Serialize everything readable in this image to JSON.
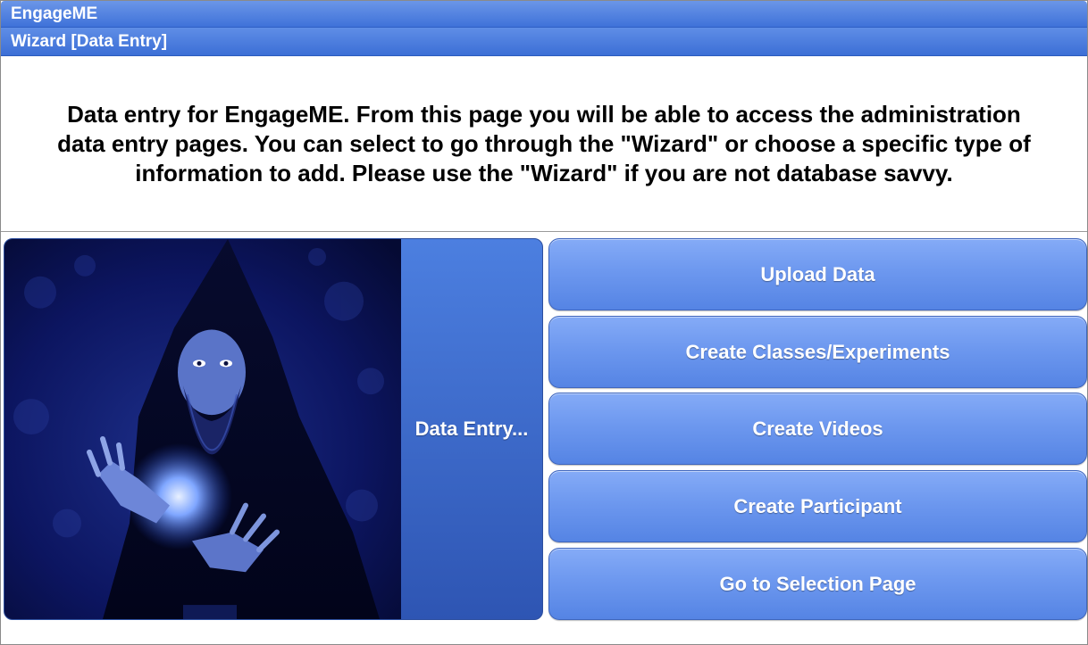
{
  "app": {
    "title": "EngageME"
  },
  "page": {
    "title": "Wizard [Data Entry]"
  },
  "intro": {
    "text": "Data entry for EngageME. From this page you will be able to access the administration\ndata entry pages.  You can select to go through the \"Wizard\" or choose a specific type of\ninformation to add.  Please use the \"Wizard\" if you are not database savvy."
  },
  "wizard": {
    "image_icon": "wizard-illustration",
    "label": "Data Entry..."
  },
  "actions": [
    {
      "label": "Upload Data"
    },
    {
      "label": "Create Classes/Experiments"
    },
    {
      "label": "Create Videos"
    },
    {
      "label": "Create Participant"
    },
    {
      "label": "Go to Selection Page"
    }
  ],
  "colors": {
    "header_blue": "#3f72d9",
    "button_blue": "#6d98ef",
    "text_dark": "#000000",
    "text_light": "#ffffff"
  }
}
